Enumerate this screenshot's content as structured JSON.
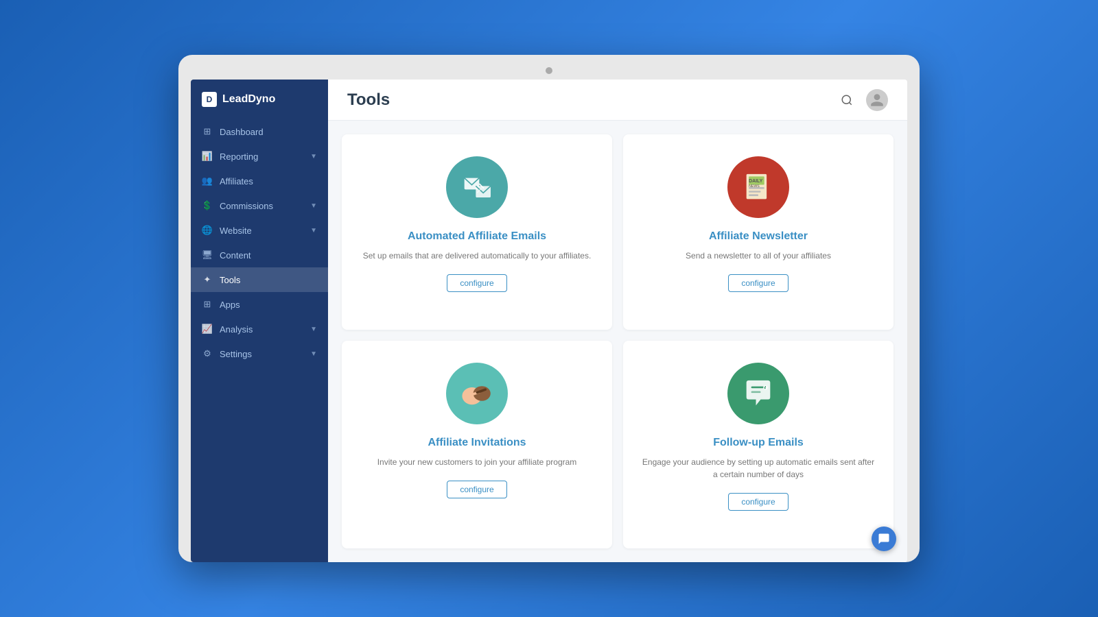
{
  "app": {
    "logo_text": "LeadDyno",
    "logo_letter": "D"
  },
  "sidebar": {
    "items": [
      {
        "id": "dashboard",
        "label": "Dashboard",
        "icon": "🏠",
        "has_chevron": false
      },
      {
        "id": "reporting",
        "label": "Reporting",
        "icon": "📊",
        "has_chevron": true
      },
      {
        "id": "affiliates",
        "label": "Affiliates",
        "icon": "👥",
        "has_chevron": false
      },
      {
        "id": "commissions",
        "label": "Commissions",
        "icon": "💰",
        "has_chevron": true
      },
      {
        "id": "website",
        "label": "Website",
        "icon": "🌐",
        "has_chevron": true
      },
      {
        "id": "content",
        "label": "Content",
        "icon": "🖥",
        "has_chevron": false
      },
      {
        "id": "tools",
        "label": "Tools",
        "icon": "✦",
        "has_chevron": false,
        "active": true
      },
      {
        "id": "apps",
        "label": "Apps",
        "icon": "⊞",
        "has_chevron": false
      },
      {
        "id": "analysis",
        "label": "Analysis",
        "icon": "📈",
        "has_chevron": true
      },
      {
        "id": "settings",
        "label": "Settings",
        "icon": "⚙",
        "has_chevron": true
      }
    ]
  },
  "header": {
    "title": "Tools"
  },
  "tools": [
    {
      "id": "automated-emails",
      "title": "Automated Affiliate Emails",
      "description": "Set up emails that are delivered automatically to your affiliates.",
      "configure_label": "configure",
      "icon_bg": "#4ba8a8",
      "icon_type": "email"
    },
    {
      "id": "affiliate-newsletter",
      "title": "Affiliate Newsletter",
      "description": "Send a newsletter to all of your affiliates",
      "configure_label": "configure",
      "icon_bg": "#c0392b",
      "icon_type": "newspaper"
    },
    {
      "id": "affiliate-invitations",
      "title": "Affiliate Invitations",
      "description": "Invite your new customers to join your affiliate program",
      "configure_label": "configure",
      "icon_bg": "#5bbfb5",
      "icon_type": "handshake"
    },
    {
      "id": "followup-emails",
      "title": "Follow-up Emails",
      "description": "Engage your audience by setting up automatic emails sent after a certain number of days",
      "configure_label": "configure",
      "icon_bg": "#3a9a6e",
      "icon_type": "chat"
    }
  ]
}
